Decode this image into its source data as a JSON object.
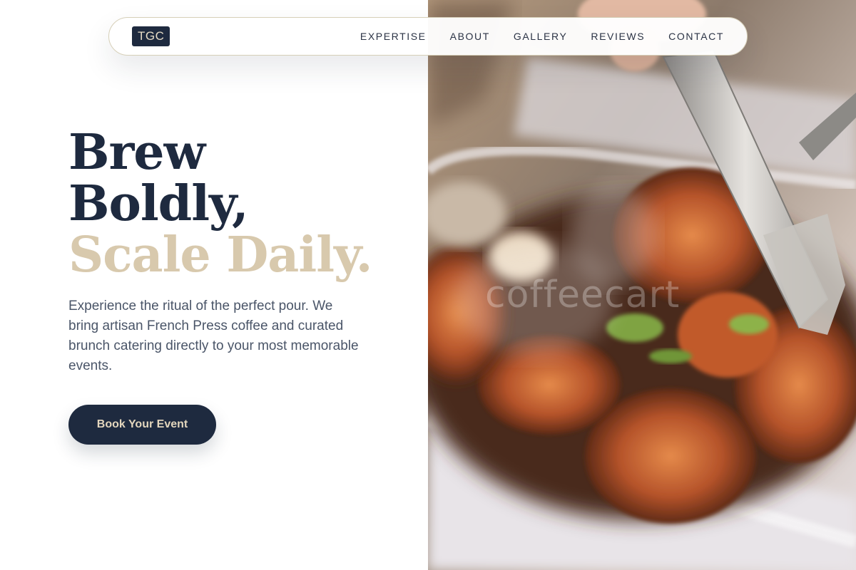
{
  "nav": {
    "logo": "TGC",
    "links": [
      "EXPERTISE",
      "ABOUT",
      "GALLERY",
      "REVIEWS",
      "CONTACT"
    ]
  },
  "hero": {
    "title_line1": "Brew",
    "title_line2": "Boldly,",
    "title_line3": "Scale Daily.",
    "description": "Experience the ritual of the perfect pour. We bring artisan French Press coffee and curated brunch catering directly to your most memorable events.",
    "cta_label": "Book Your Event"
  },
  "photo": {
    "watermark": "coffeecart"
  },
  "colors": {
    "navy": "#1e2a3f",
    "beige": "#d8c9ad",
    "text_muted": "#4a5568"
  }
}
